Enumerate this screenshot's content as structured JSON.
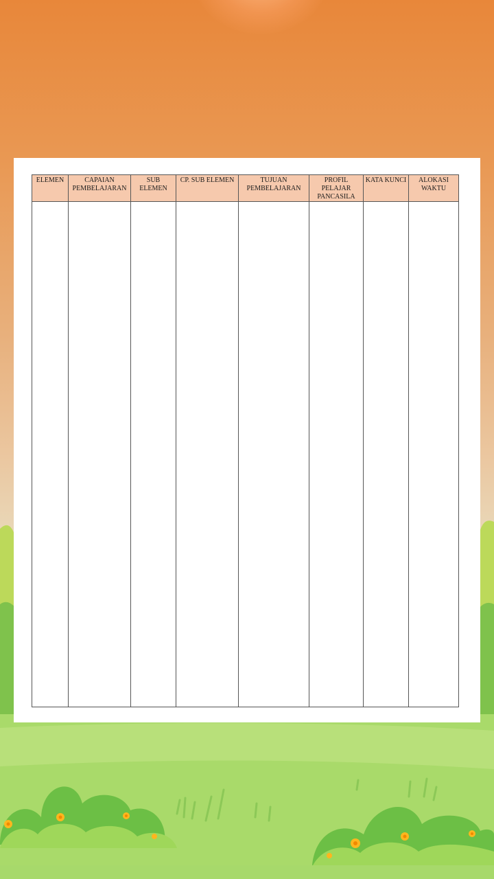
{
  "document": {
    "table": {
      "columns": [
        "ELEMEN",
        "CAPAIAN PEMBELAJARAN",
        "SUB ELEMEN",
        "CP. SUB ELEMEN",
        "TUJUAN PEMBELAJARAN",
        "PROFIL PELAJAR PANCASILA",
        "KATA KUNCI",
        "ALOKASI WAKTU"
      ],
      "header_color": "#f6c9ad"
    }
  },
  "background": {
    "sky_top": "#e8873a",
    "grass": "#a7d96b",
    "bush_dark": "#6cbf45",
    "bush_light": "#9fd75a",
    "flower": "#ffb61e"
  }
}
